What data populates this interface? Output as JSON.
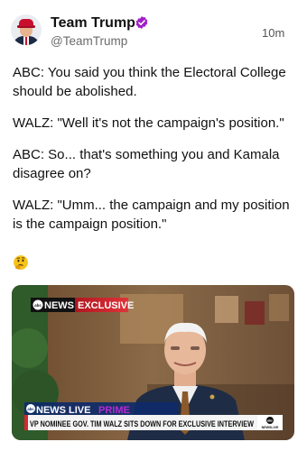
{
  "post": {
    "author": {
      "name": "Team Trump",
      "handle": "@TeamTrump",
      "verified": true,
      "verified_badge_color": "#a020c8",
      "avatar_icon": "avatar-portrait"
    },
    "timestamp": "10m",
    "paragraphs": [
      "ABC: You said you think the Electoral College should be abolished.",
      "WALZ: \"Well it's not the campaign's position.\"",
      "ABC: So... that's something you and Kamala disagree on?",
      "WALZ: \"Umm... the campaign and my position is the campaign position.\""
    ],
    "emoji": "thinking-face",
    "media": {
      "top_badge_network": "NEWS",
      "top_badge_label": "EXCLUSIVE",
      "bottom_network": "NEWS",
      "bottom_live": "LIVE",
      "bottom_prime": "PRIME",
      "chyron": "VP NOMINEE GOV. TIM WALZ SITS DOWN FOR EXCLUSIVE INTERVIEW",
      "corner_logo_text": "NEWSLIVE",
      "accent_red": "#d6262f",
      "prime_purple": "#b52bd6"
    }
  }
}
